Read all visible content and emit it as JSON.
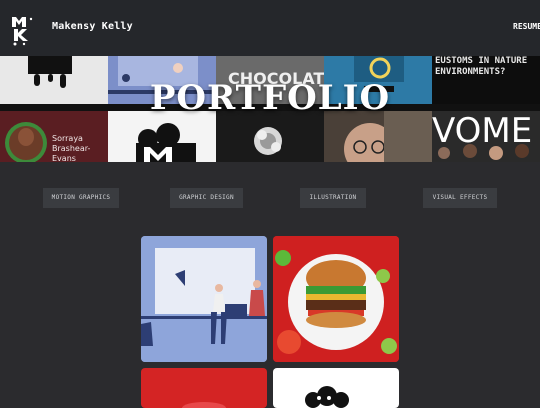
{
  "header": {
    "logo_letters": "MK",
    "site_name": "Makensy Kelly",
    "resume_label": "RESUME"
  },
  "hero": {
    "title": "PORTFOLIO",
    "tiles": {
      "chocolate": "CHOCOLATE",
      "environments": "EUSTOMS IN NATURE ENVIRONMENTS?",
      "person_name": "Sorraya Brashear-Evans",
      "women_fragment": "VOME"
    }
  },
  "filters": [
    "MOTION GRAPHICS",
    "GRAPHIC DESIGN",
    "ILLUSTRATION",
    "VISUAL EFFECTS"
  ],
  "colors": {
    "background": "#2b2b2e",
    "topbar": "#25272b",
    "filter_bg": "#3a3c40",
    "red_card": "#d42424",
    "blue_card": "#8aa1d6"
  }
}
